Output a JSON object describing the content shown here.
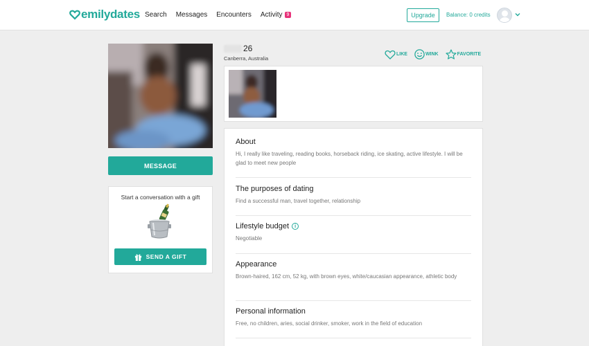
{
  "header": {
    "logo_text": "emilydates",
    "nav": [
      {
        "label": "Search"
      },
      {
        "label": "Messages"
      },
      {
        "label": "Encounters"
      },
      {
        "label": "Activity",
        "badge": "9"
      }
    ],
    "upgrade_label": "Upgrade",
    "balance": "Balance: 0 credits"
  },
  "profile": {
    "age": "26",
    "location": "Canberra, Australia",
    "actions": [
      {
        "label": "LIKE",
        "icon": "heart-icon"
      },
      {
        "label": "WINK",
        "icon": "wink-icon"
      },
      {
        "label": "FAVORITE",
        "icon": "star-icon"
      }
    ],
    "message_label": "MESSAGE"
  },
  "gift": {
    "title": "Start a conversation with a gift",
    "button_label": "SEND A GIFT",
    "icon": "gift-icon"
  },
  "sections": [
    {
      "title": "About",
      "text": "Hi, I really like traveling, reading books, horseback riding, ice skating, active lifestyle. I will be glad to meet new people"
    },
    {
      "title": "The purposes of dating",
      "text": "Find a successful man, travel together, relationship"
    },
    {
      "title": "Lifestyle budget",
      "text": "Negotiable",
      "info_icon": true
    },
    {
      "title": "Appearance",
      "text": "Brown-haired, 162 cm, 52 kg, with brown eyes, white/caucasian appearance, athletic body"
    },
    {
      "title": "Personal information",
      "text": "Free, no children, aries, social drinker, smoker, work in the field of education"
    }
  ],
  "colors": {
    "accent": "#22a99a",
    "badge": "#e8327a",
    "background": "#eeeeee"
  }
}
